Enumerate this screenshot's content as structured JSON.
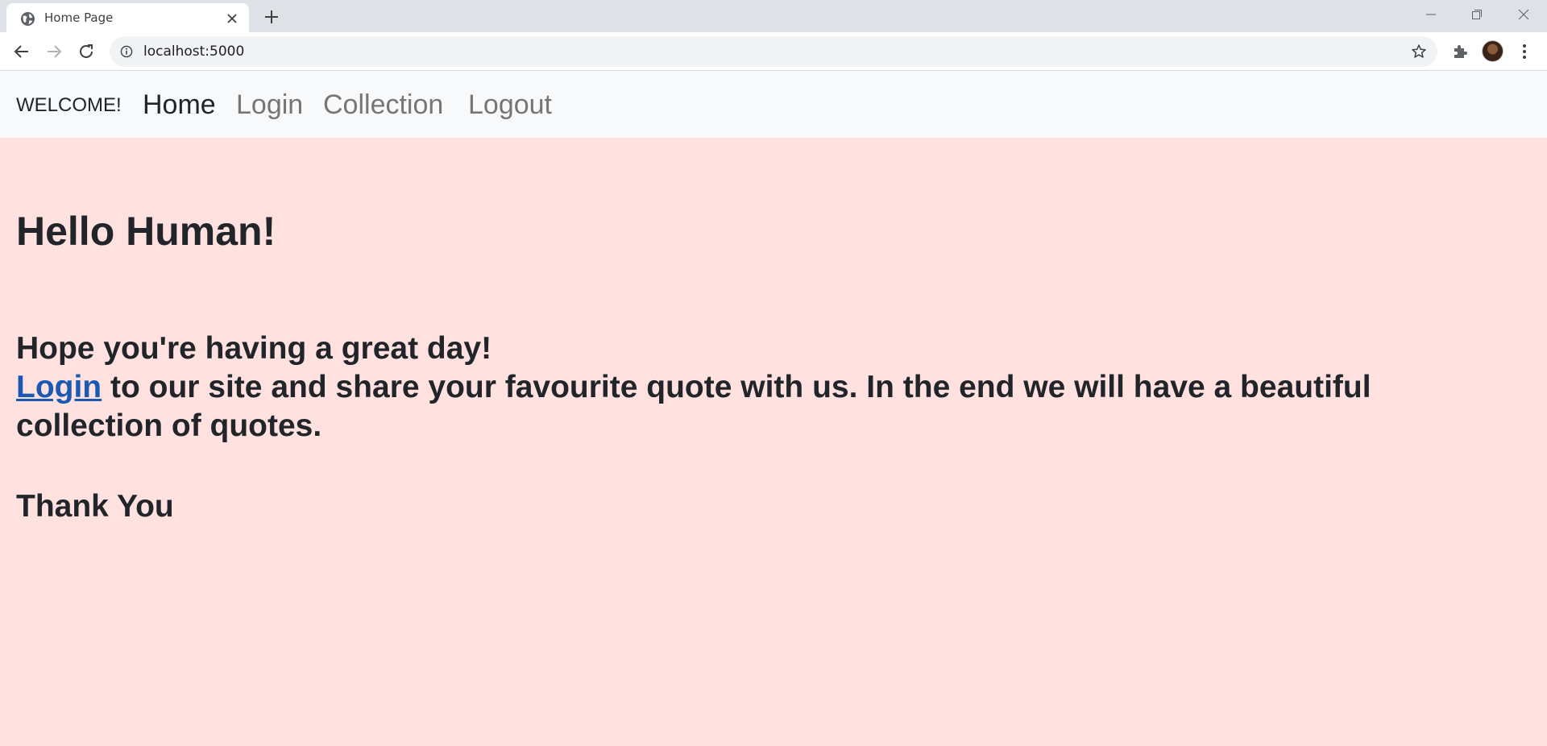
{
  "browser": {
    "tab_title": "Home Page",
    "url": "localhost:5000",
    "icons": {
      "favicon": "globe-icon",
      "tab_close": "close-icon",
      "new_tab": "plus-icon",
      "back": "arrow-left-icon",
      "forward": "arrow-right-icon",
      "reload": "reload-icon",
      "site_info": "info-icon",
      "bookmark": "star-icon",
      "extensions": "puzzle-icon",
      "menu": "kebab-menu-icon"
    }
  },
  "navbar": {
    "brand": "WELCOME!",
    "links": [
      {
        "label": "Home",
        "active": true
      },
      {
        "label": "Login",
        "active": false
      },
      {
        "label": "Collection",
        "active": false
      },
      {
        "label": "Logout",
        "active": false
      }
    ]
  },
  "content": {
    "heading": "Hello Human!",
    "line1": "Hope you're having a great day!",
    "login_link": "Login",
    "line2": " to our site and share your favourite quote with us. In the end we will have a beautiful collection of quotes.",
    "thanks": "Thank You"
  },
  "colors": {
    "page_background": "#ffe1e0",
    "navbar_background": "#f8f9fa",
    "link": "#1a5ab3",
    "inactive_nav": "#767676",
    "text": "#212529"
  }
}
